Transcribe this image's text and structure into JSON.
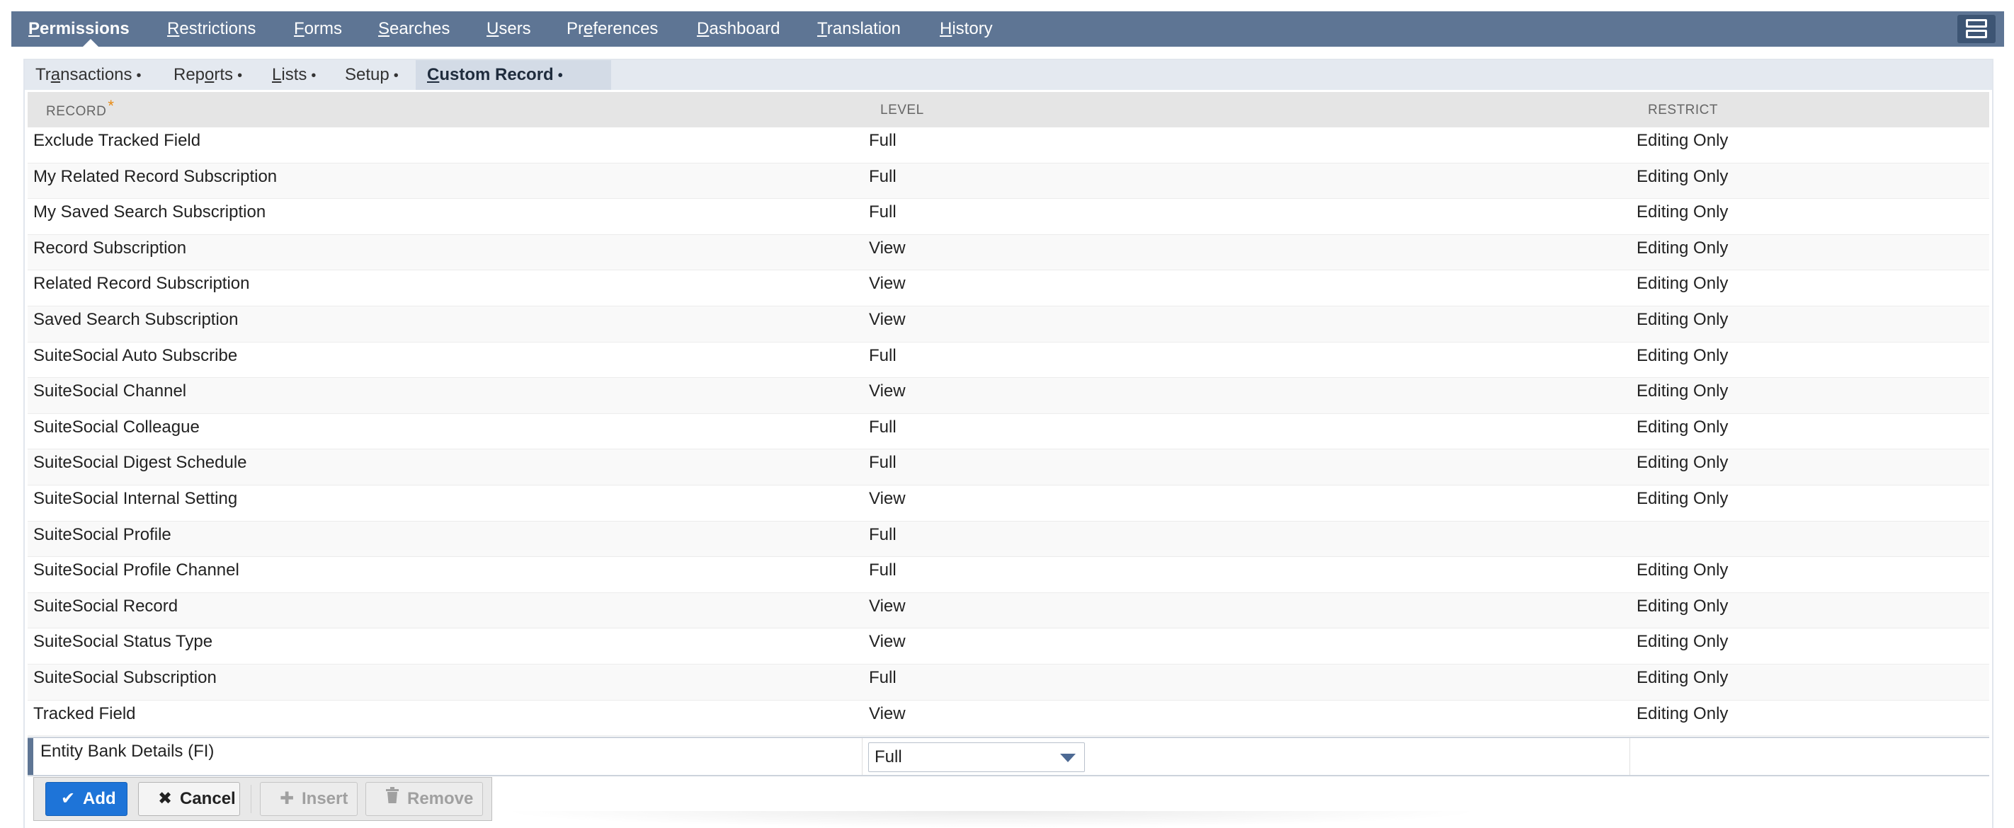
{
  "top_nav": {
    "tabs": [
      {
        "pre": "",
        "u": "P",
        "post": "ermissions",
        "active": true
      },
      {
        "pre": "",
        "u": "R",
        "post": "estrictions"
      },
      {
        "pre": "",
        "u": "F",
        "post": "orms"
      },
      {
        "pre": "",
        "u": "S",
        "post": "earches"
      },
      {
        "pre": "",
        "u": "U",
        "post": "sers"
      },
      {
        "pre": "Pr",
        "u": "e",
        "post": "ferences"
      },
      {
        "pre": "",
        "u": "D",
        "post": "ashboard"
      },
      {
        "pre": "",
        "u": "T",
        "post": "ranslation"
      },
      {
        "pre": "",
        "u": "H",
        "post": "istory"
      }
    ],
    "layout_icon": "layout-toggle-icon"
  },
  "sub_tabs": [
    {
      "pre": "Tr",
      "u": "a",
      "post": "nsactions",
      "dot": "•"
    },
    {
      "pre": "Rep",
      "u": "o",
      "post": "rts",
      "dot": "•"
    },
    {
      "pre": "",
      "u": "L",
      "post": "ists",
      "dot": "•"
    },
    {
      "pre": "Setup",
      "u": "",
      "post": "",
      "dot": "•"
    },
    {
      "pre": "",
      "u": "C",
      "post": "ustom Record",
      "dot": "•",
      "active": true
    }
  ],
  "table": {
    "headers": {
      "record": "RECORD",
      "required_mark": "*",
      "level": "LEVEL",
      "restrict": "RESTRICT"
    },
    "rows": [
      {
        "record": "Exclude Tracked Field",
        "level": "Full",
        "restrict": "Editing Only"
      },
      {
        "record": "My Related Record Subscription",
        "level": "Full",
        "restrict": "Editing Only"
      },
      {
        "record": "My Saved Search Subscription",
        "level": "Full",
        "restrict": "Editing Only"
      },
      {
        "record": "Record Subscription",
        "level": "View",
        "restrict": "Editing Only"
      },
      {
        "record": "Related Record Subscription",
        "level": "View",
        "restrict": "Editing Only"
      },
      {
        "record": "Saved Search Subscription",
        "level": "View",
        "restrict": "Editing Only"
      },
      {
        "record": "SuiteSocial Auto Subscribe",
        "level": "Full",
        "restrict": "Editing Only"
      },
      {
        "record": "SuiteSocial Channel",
        "level": "View",
        "restrict": "Editing Only"
      },
      {
        "record": "SuiteSocial Colleague",
        "level": "Full",
        "restrict": "Editing Only"
      },
      {
        "record": "SuiteSocial Digest Schedule",
        "level": "Full",
        "restrict": "Editing Only"
      },
      {
        "record": "SuiteSocial Internal Setting",
        "level": "View",
        "restrict": "Editing Only"
      },
      {
        "record": "SuiteSocial Profile",
        "level": "Full",
        "restrict": ""
      },
      {
        "record": "SuiteSocial Profile Channel",
        "level": "Full",
        "restrict": "Editing Only"
      },
      {
        "record": "SuiteSocial Record",
        "level": "View",
        "restrict": "Editing Only"
      },
      {
        "record": "SuiteSocial Status Type",
        "level": "View",
        "restrict": "Editing Only"
      },
      {
        "record": "SuiteSocial Subscription",
        "level": "Full",
        "restrict": "Editing Only"
      },
      {
        "record": "Tracked Field",
        "level": "View",
        "restrict": "Editing Only"
      }
    ],
    "edit_row": {
      "record": "Entity Bank Details (FI)",
      "level_selected": "Full"
    }
  },
  "buttons": {
    "add": "Add",
    "cancel": "Cancel",
    "insert": "Insert",
    "remove": "Remove"
  },
  "colors": {
    "nav_bg": "#5e7594",
    "primary_button": "#1e74d8",
    "required_mark": "#e88a12"
  }
}
